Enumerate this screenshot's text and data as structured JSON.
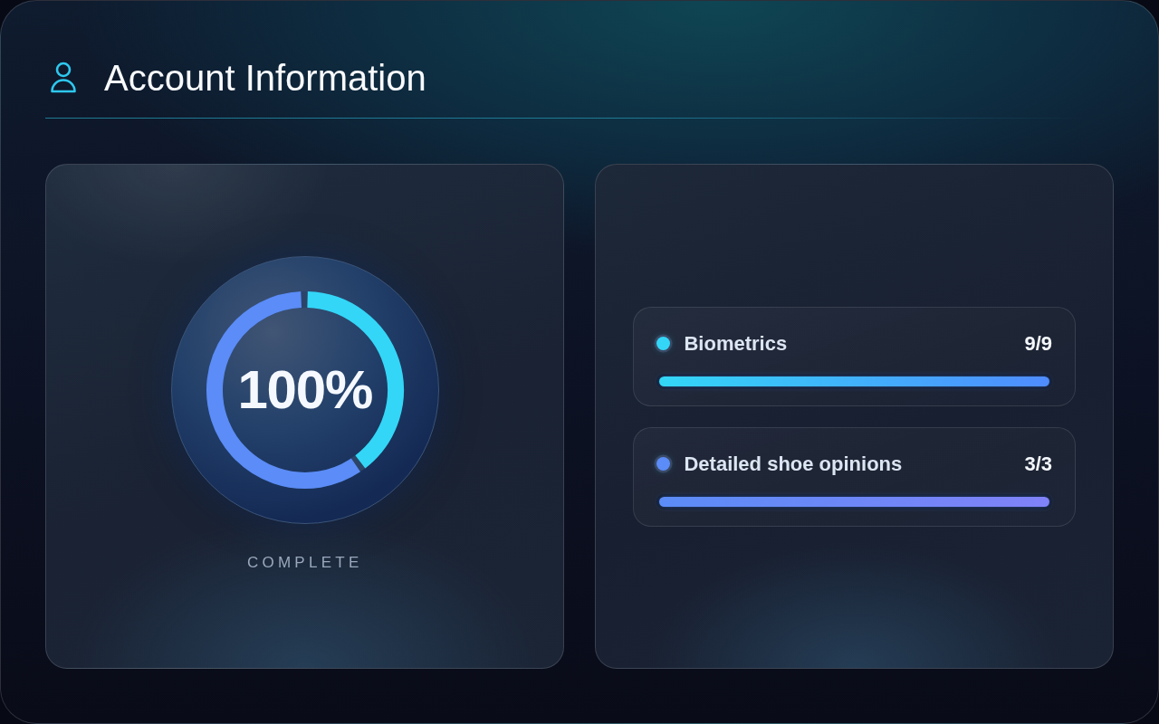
{
  "header": {
    "title": "Account Information"
  },
  "progress": {
    "value_text": "100%",
    "level": 1,
    "caption": "COMPLETE"
  },
  "categories": [
    {
      "name": "Biometrics",
      "count": "9/9",
      "level": 1,
      "color": "#33d6f7"
    },
    {
      "name": "Detailed shoe opinions",
      "count": "3/3",
      "level": 1,
      "color": "#5b8cf7"
    }
  ]
}
